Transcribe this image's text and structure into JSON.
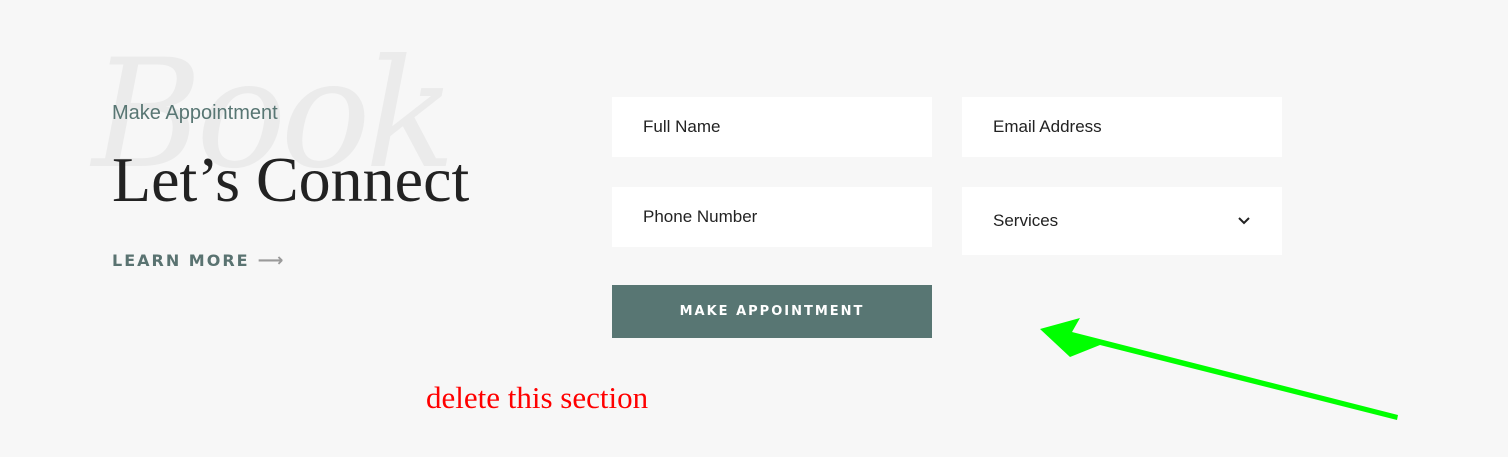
{
  "section": {
    "watermark": "Book",
    "eyebrow": "Make Appointment",
    "headline": "Let’s Connect",
    "learn_more": "LEARN MORE",
    "learn_more_arrow": "⟶"
  },
  "form": {
    "full_name_placeholder": "Full Name",
    "email_placeholder": "Email Address",
    "phone_placeholder": "Phone Number",
    "services_selected": "Services",
    "submit_label": "MAKE APPOINTMENT"
  },
  "annotation": {
    "text": "delete this section",
    "text_color": "#ff0000",
    "arrow_color": "#00ff00"
  },
  "colors": {
    "background": "#f7f7f7",
    "accent": "#587673",
    "field_bg": "#ffffff"
  },
  "icons": {
    "dropdown": "chevron-down-icon",
    "learn_more_arrow": "arrow-right-icon"
  }
}
